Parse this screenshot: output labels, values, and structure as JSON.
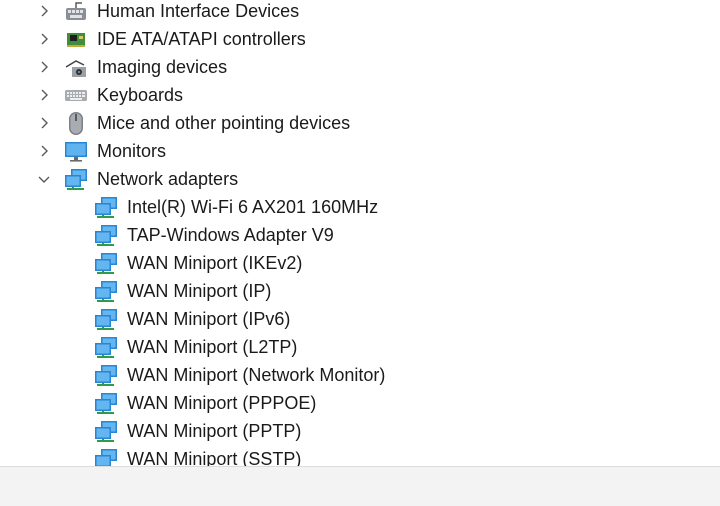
{
  "tree": {
    "categories": [
      {
        "label": "Human Interface Devices",
        "icon": "hid-icon",
        "expanded": false
      },
      {
        "label": "IDE ATA/ATAPI controllers",
        "icon": "ide-controller-icon",
        "expanded": false
      },
      {
        "label": "Imaging devices",
        "icon": "camera-icon",
        "expanded": false
      },
      {
        "label": "Keyboards",
        "icon": "keyboard-icon",
        "expanded": false
      },
      {
        "label": "Mice and other pointing devices",
        "icon": "mouse-icon",
        "expanded": false
      },
      {
        "label": "Monitors",
        "icon": "monitor-icon",
        "expanded": false
      },
      {
        "label": "Network adapters",
        "icon": "network-adapter-icon",
        "expanded": true
      }
    ],
    "network_adapters": [
      "Intel(R) Wi-Fi 6 AX201 160MHz",
      "TAP-Windows Adapter V9",
      "WAN Miniport (IKEv2)",
      "WAN Miniport (IP)",
      "WAN Miniport (IPv6)",
      "WAN Miniport (L2TP)",
      "WAN Miniport (Network Monitor)",
      "WAN Miniport (PPPOE)",
      "WAN Miniport (PPTP)",
      "WAN Miniport (SSTP)"
    ]
  },
  "colors": {
    "accent": "#2b8fd6",
    "chevron": "#5a5a5a",
    "scrollbar_bg": "#f3f3f3"
  }
}
